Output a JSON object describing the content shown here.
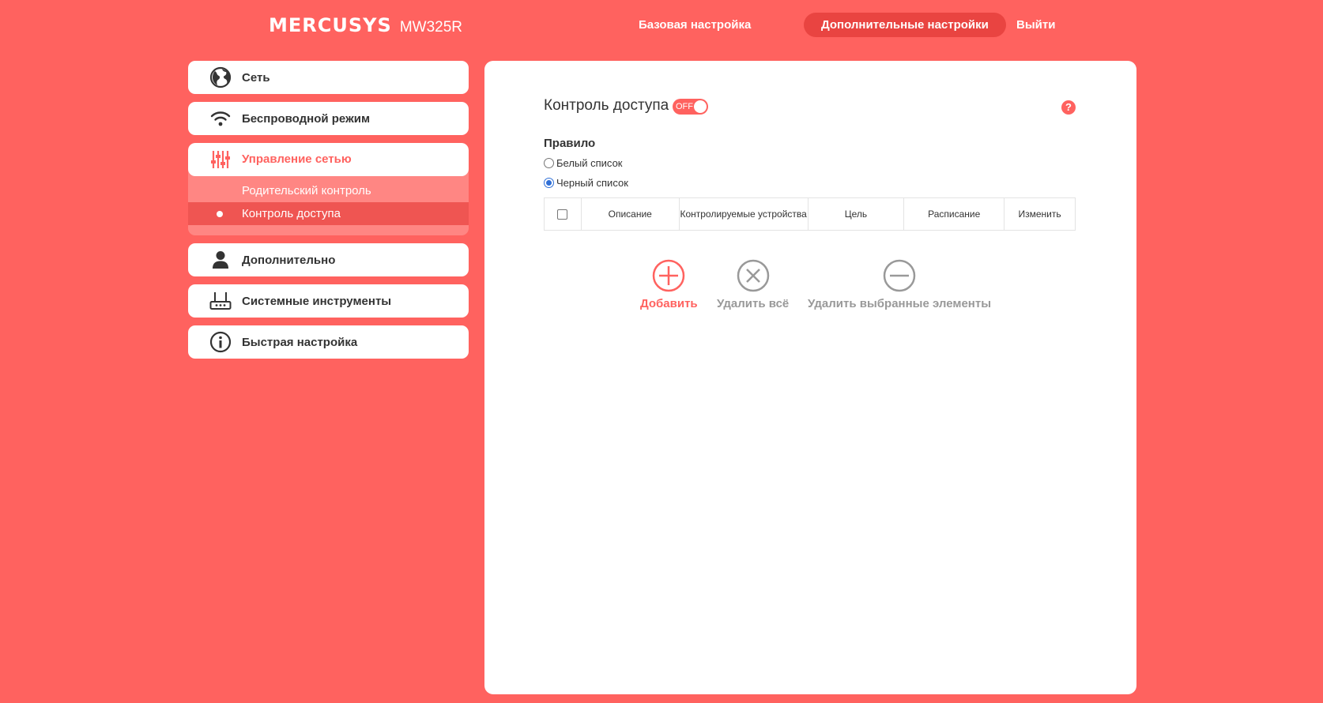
{
  "header": {
    "brand": "MERCUSYS",
    "model": "MW325R",
    "nav": {
      "basic": "Базовая настройка",
      "advanced": "Дополнительные настройки",
      "logout": "Выйти"
    }
  },
  "sidebar": {
    "items": [
      {
        "label": "Сеть",
        "icon": "globe-icon"
      },
      {
        "label": "Беспроводной режим",
        "icon": "wifi-icon"
      },
      {
        "label": "Управление сетью",
        "icon": "sliders-icon",
        "expanded": true,
        "children": [
          {
            "label": "Родительский контроль"
          },
          {
            "label": "Контроль доступа",
            "active": true
          }
        ]
      },
      {
        "label": "Дополнительно",
        "icon": "user-icon"
      },
      {
        "label": "Системные инструменты",
        "icon": "router-icon"
      },
      {
        "label": "Быстрая настройка",
        "icon": "info-icon"
      }
    ]
  },
  "main": {
    "title": "Контроль доступа",
    "toggle": {
      "state": "OFF"
    },
    "help": "?",
    "rule_label": "Правило",
    "rule_options": [
      {
        "label": "Белый список",
        "checked": false
      },
      {
        "label": "Черный список",
        "checked": true
      }
    ],
    "table": {
      "columns": [
        "Описание",
        "Контролируемые устройства",
        "Цель",
        "Расписание",
        "Изменить"
      ],
      "rows": []
    },
    "actions": {
      "add": "Добавить",
      "delete_all": "Удалить всё",
      "delete_selected": "Удалить выбранные элементы"
    }
  },
  "colors": {
    "accent": "#FF625F",
    "nav_active": "#E94441",
    "submenu": "#FF8683",
    "submenu_active": "#EF5552"
  }
}
